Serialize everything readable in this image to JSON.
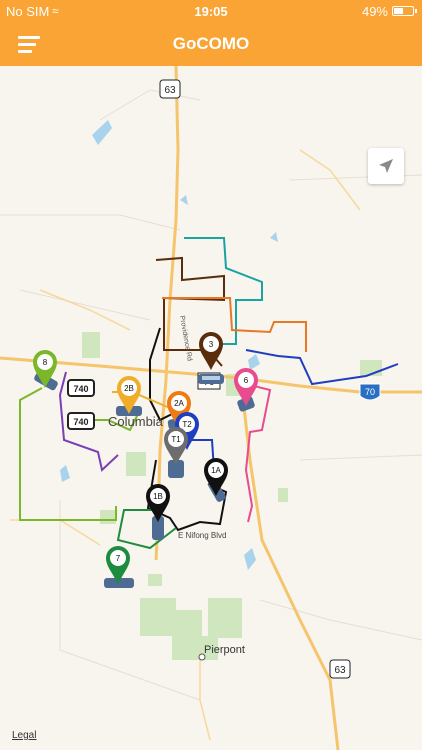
{
  "status": {
    "carrier": "No SIM",
    "time": "19:05",
    "battery": "49%",
    "battery_level": 0.49
  },
  "header": {
    "title": "GoCOMO"
  },
  "map": {
    "city_label": "Columbia",
    "street_label": "E Nifong Blvd",
    "road_label": "Providence Rd",
    "town_label": "Pierpont",
    "highway_labels": [
      "63",
      "70",
      "740",
      "740",
      "70",
      "63"
    ],
    "legal": "Legal"
  },
  "routes": [
    {
      "id": "3",
      "label": "3",
      "color": "#5a2d0c"
    },
    {
      "id": "6",
      "label": "6",
      "color": "#e84b8e"
    },
    {
      "id": "8",
      "label": "8",
      "color": "#7ab829"
    },
    {
      "id": "2B",
      "label": "2B",
      "color": "#f0ad2a"
    },
    {
      "id": "2A",
      "label": "2A",
      "color": "#f07a12"
    },
    {
      "id": "T2",
      "label": "T2",
      "color": "#1f3fbf"
    },
    {
      "id": "T1",
      "label": "T1",
      "color": "#6d6d6d"
    },
    {
      "id": "1A",
      "label": "1A",
      "color": "#111111"
    },
    {
      "id": "1B",
      "label": "1B",
      "color": "#111111"
    },
    {
      "id": "7",
      "label": "7",
      "color": "#1e8c3e"
    }
  ]
}
